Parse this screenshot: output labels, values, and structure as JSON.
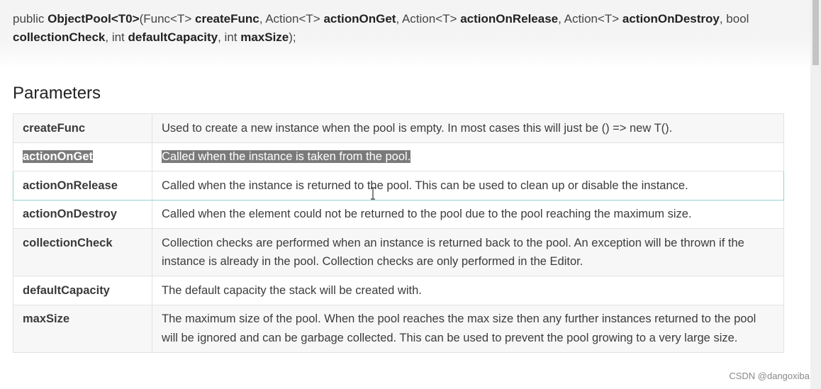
{
  "signature": {
    "public": "public ",
    "class_name": "ObjectPool<T0>",
    "open": "(Func<T> ",
    "p1": "createFunc",
    "s1": ", Action<T> ",
    "p2": "actionOnGet",
    "s2": ", Action<T> ",
    "p3": "actionOnRelease",
    "s3": ", Action<T> ",
    "p4": "actionOnDestroy",
    "s4": ", bool ",
    "p5": "collectionCheck",
    "s5": ", int ",
    "p6": "defaultCapacity",
    "s6": ", int ",
    "p7": "maxSize",
    "close": ");"
  },
  "section_title": "Parameters",
  "parameters": [
    {
      "name": "createFunc",
      "description": "Used to create a new instance when the pool is empty. In most cases this will just be () => new T()."
    },
    {
      "name": "actionOnGet",
      "description": "Called when the instance is taken from the pool."
    },
    {
      "name": "actionOnRelease",
      "description": "Called when the instance is returned to the pool. This can be used to clean up or disable the instance."
    },
    {
      "name": "actionOnDestroy",
      "description": "Called when the element could not be returned to the pool due to the pool reaching the maximum size."
    },
    {
      "name": "collectionCheck",
      "description": "Collection checks are performed when an instance is returned back to the pool. An exception will be thrown if the instance is already in the pool. Collection checks are only performed in the Editor."
    },
    {
      "name": "defaultCapacity",
      "description": "The default capacity the stack will be created with."
    },
    {
      "name": "maxSize",
      "description": "The maximum size of the pool. When the pool reaches the max size then any further instances returned to the pool will be ignored and can be garbage collected. This can be used to prevent the pool growing to a very large size."
    }
  ],
  "watermark": "CSDN @dangoxiba",
  "colors": {
    "selection": "#7a7a7a",
    "hover_border": "#8fd3d3",
    "row_shade": "#f7f7f7"
  }
}
